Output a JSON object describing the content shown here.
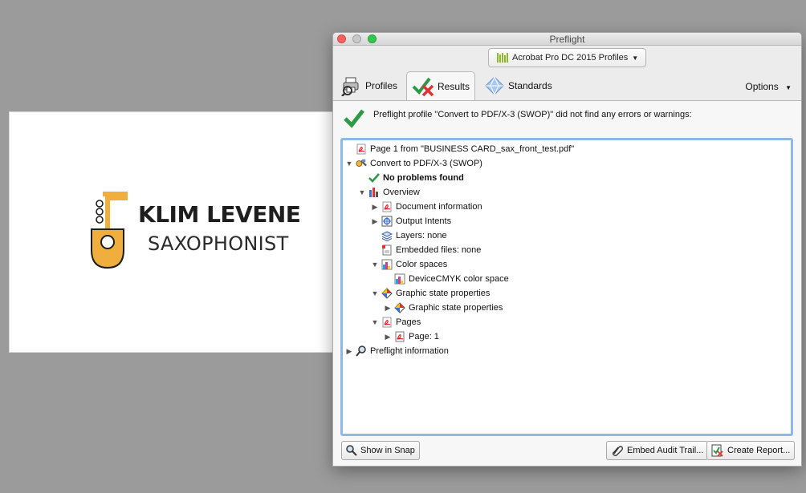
{
  "card": {
    "name": "KLIM LEVENE",
    "subtitle": "SAXOPHONIST",
    "accent": "#f0ae3c"
  },
  "window": {
    "title": "Preflight",
    "profile_dropdown": "Acrobat Pro DC 2015 Profiles",
    "tabs": [
      {
        "label": "Profiles",
        "icon": "profiles-printer-icon"
      },
      {
        "label": "Results",
        "icon": "results-check-icon",
        "selected": true
      },
      {
        "label": "Standards",
        "icon": "standards-diamond-icon"
      }
    ],
    "options_label": "Options",
    "result_message": "Preflight profile \"Convert to PDF/X-3 (SWOP)\" did not find any errors or warnings:",
    "tree": [
      {
        "label": "Page 1 from \"BUSINESS CARD_sax_front_test.pdf\"",
        "level": 0,
        "toggle": "",
        "icon": "pdf-icon"
      },
      {
        "label": "Convert to PDF/X-3 (SWOP)",
        "level": 0,
        "toggle": "down",
        "icon": "fixup-icon"
      },
      {
        "label": "No problems found",
        "level": 1,
        "toggle": "",
        "icon": "check-icon",
        "bold": true
      },
      {
        "label": "Overview",
        "level": 1,
        "toggle": "down",
        "icon": "overview-icon"
      },
      {
        "label": "Document information",
        "level": 2,
        "toggle": "right",
        "icon": "pdf-icon"
      },
      {
        "label": "Output Intents",
        "level": 2,
        "toggle": "right",
        "icon": "output-intent-icon"
      },
      {
        "label": "Layers: none",
        "level": 2,
        "toggle": "",
        "icon": "layers-icon"
      },
      {
        "label": "Embedded files: none",
        "level": 2,
        "toggle": "",
        "icon": "embedded-file-icon"
      },
      {
        "label": "Color spaces",
        "level": 2,
        "toggle": "down",
        "icon": "color-space-icon"
      },
      {
        "label": "DeviceCMYK color space",
        "level": 3,
        "toggle": "",
        "icon": "color-space-icon"
      },
      {
        "label": "Graphic state properties",
        "level": 2,
        "toggle": "down",
        "icon": "graphic-state-icon"
      },
      {
        "label": "Graphic state properties",
        "level": 3,
        "toggle": "right",
        "icon": "graphic-state-icon"
      },
      {
        "label": "Pages",
        "level": 2,
        "toggle": "down",
        "icon": "pdf-icon"
      },
      {
        "label": "Page: 1",
        "level": 3,
        "toggle": "right",
        "icon": "pdf-page-icon"
      },
      {
        "label": "Preflight information",
        "level": 0,
        "toggle": "right",
        "icon": "magnifier-icon"
      }
    ],
    "buttons": {
      "show_in_snap": "Show in Snap",
      "embed_audit_trail": "Embed Audit Trail...",
      "create_report": "Create Report..."
    }
  }
}
